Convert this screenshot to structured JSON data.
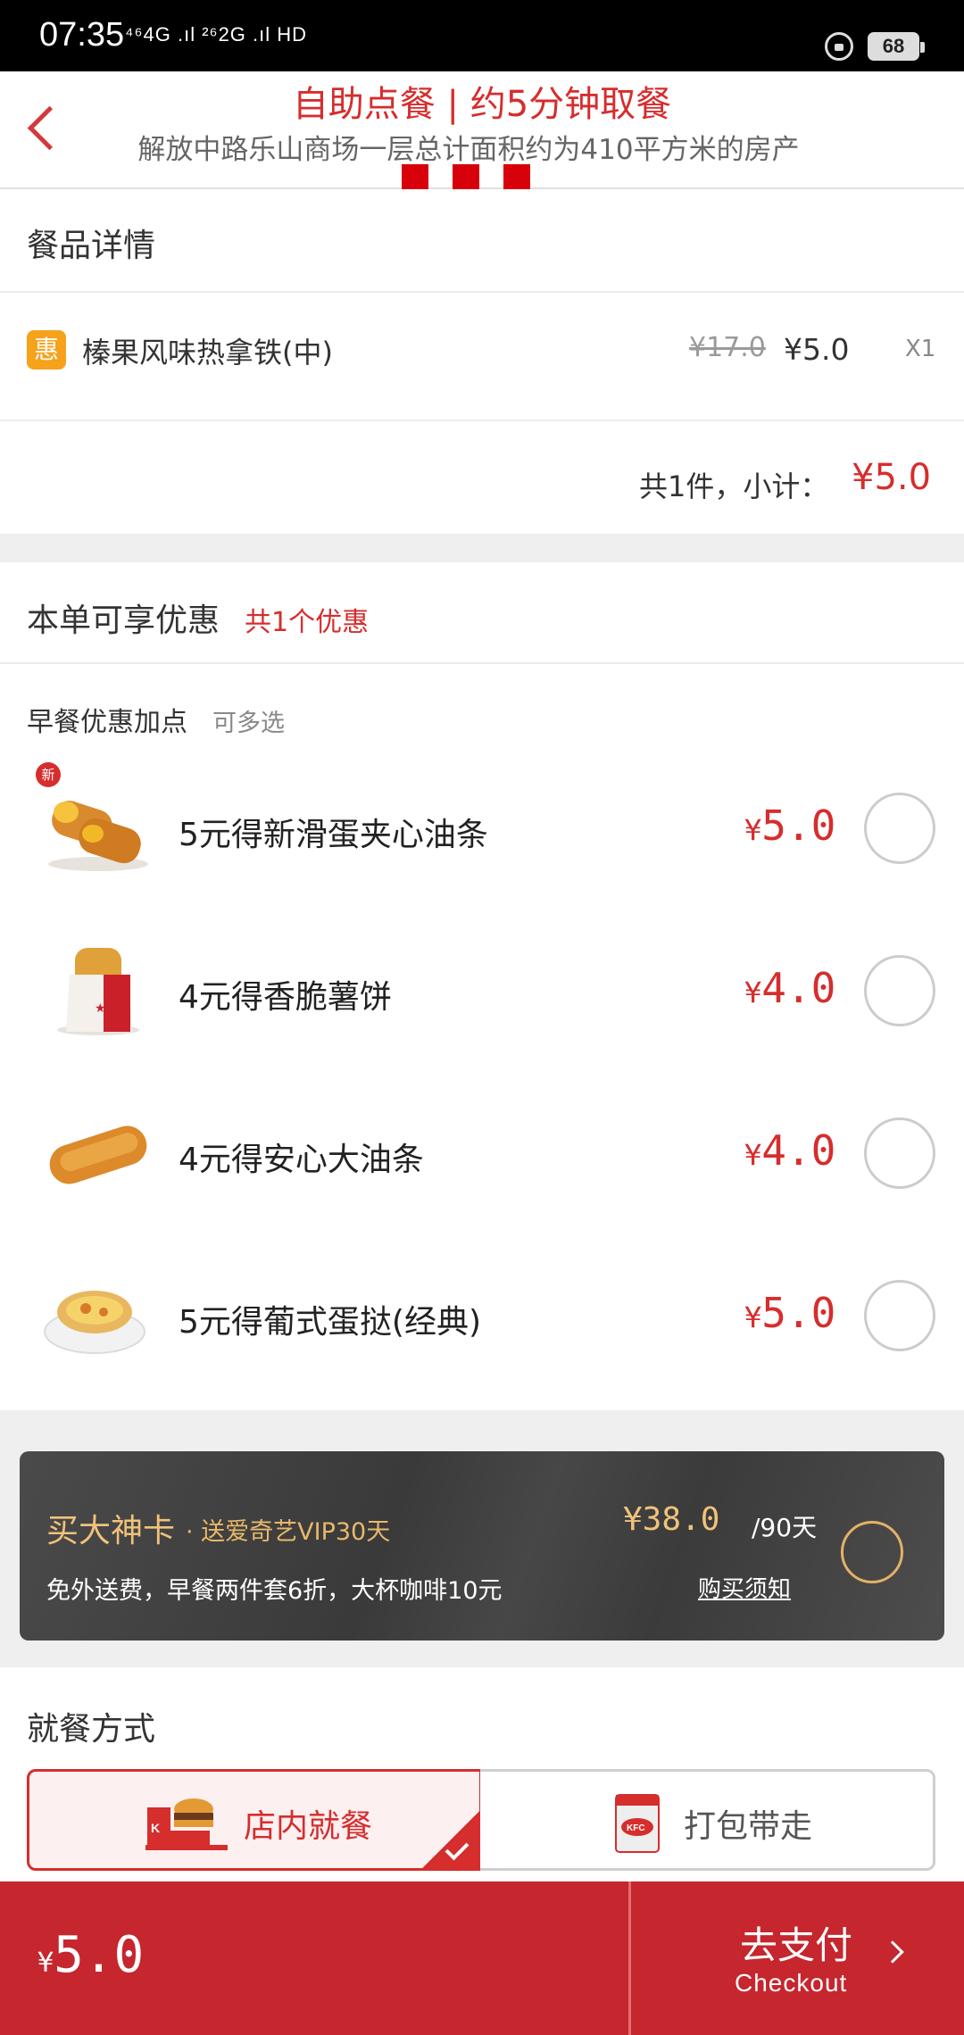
{
  "status_bar": {
    "time": "07:35",
    "network": "⁴⁶4G .ıl ²⁶2G .ıl HD",
    "battery": "68"
  },
  "header": {
    "title": "自助点餐 | 约5分钟取餐",
    "subtitle": "解放中路乐山商场一层总计面积约为410平方米的房产"
  },
  "order_detail": {
    "section_title": "餐品详情",
    "item": {
      "badge": "惠",
      "name": "榛果风味热拿铁(中)",
      "original_price": "¥17.0",
      "price": "¥5.0",
      "quantity": "X1"
    },
    "subtotal_label": "共1件，小计：",
    "subtotal_value": "¥5.0"
  },
  "discounts": {
    "section_title": "本单可享优惠",
    "count_label": "共1个优惠",
    "group_label": "早餐优惠加点",
    "group_hint": "可多选",
    "new_tag": "新",
    "items": [
      {
        "name": "5元得新滑蛋夹心油条",
        "currency": "¥",
        "price": "5.0"
      },
      {
        "name": "4元得香脆薯饼",
        "currency": "¥",
        "price": "4.0"
      },
      {
        "name": "4元得安心大油条",
        "currency": "¥",
        "price": "4.0"
      },
      {
        "name": "5元得葡式蛋挞(经典)",
        "currency": "¥",
        "price": "5.0"
      }
    ]
  },
  "vip_card": {
    "title": "买大神卡",
    "subtitle": "· 送爱奇艺VIP30天",
    "description": "免外送费，早餐两件套6折，大杯咖啡10元",
    "price": "¥38.0",
    "period": "/90天",
    "notice_link": "购买须知"
  },
  "dining": {
    "section_title": "就餐方式",
    "options": [
      {
        "label": "店内就餐",
        "selected": true
      },
      {
        "label": "打包带走",
        "selected": false
      }
    ]
  },
  "bottom_bar": {
    "currency": "¥",
    "total": "5.0",
    "checkout_label": "去支付",
    "checkout_sub": "Checkout"
  },
  "colors": {
    "accent_red": "#d62d2d",
    "bottom_bar": "#c6262e",
    "vip_gold": "#f0c27a",
    "badge_orange": "#f6a21b"
  }
}
